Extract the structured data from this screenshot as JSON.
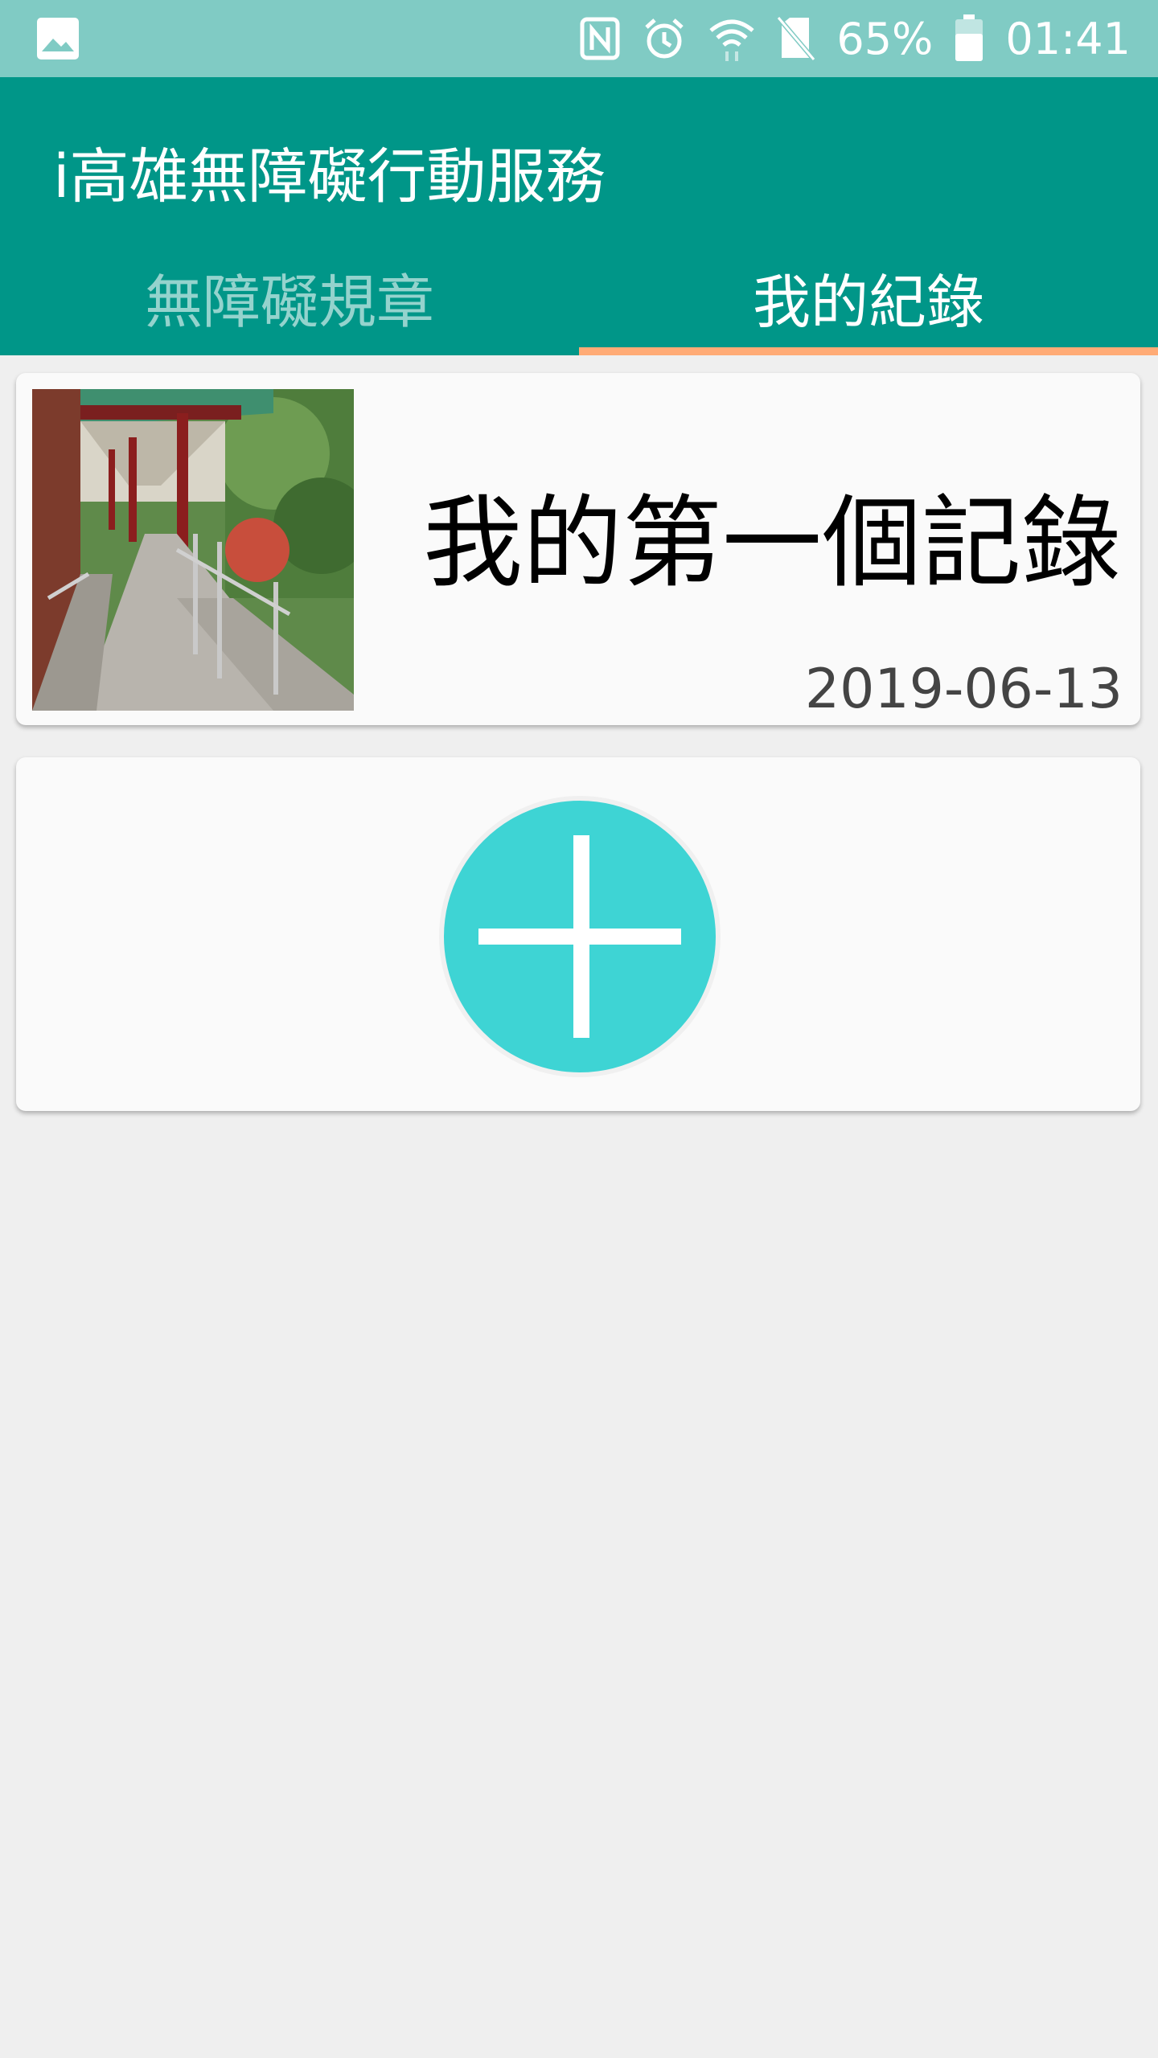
{
  "status_bar": {
    "icons": [
      "gallery-icon",
      "nfc-icon",
      "alarm-icon",
      "wifi-icon",
      "no-sim-icon",
      "battery-icon"
    ],
    "battery": "65%",
    "time": "01:41"
  },
  "app_bar": {
    "title": "i高雄無障礙行動服務"
  },
  "tabs": [
    {
      "label": "無障礙規章",
      "selected": false
    },
    {
      "label": "我的紀錄",
      "selected": true
    }
  ],
  "records": [
    {
      "title": "我的第一個記錄",
      "date": "2019-06-13",
      "thumbnail": "corridor-photo"
    }
  ],
  "add_button": {
    "icon": "plus-icon"
  },
  "colors": {
    "status_bar": "#80cbc4",
    "app_bar": "#009688",
    "tab_indicator": "#ffab76",
    "add_button": "#3ed4d4",
    "background": "#efefef"
  }
}
